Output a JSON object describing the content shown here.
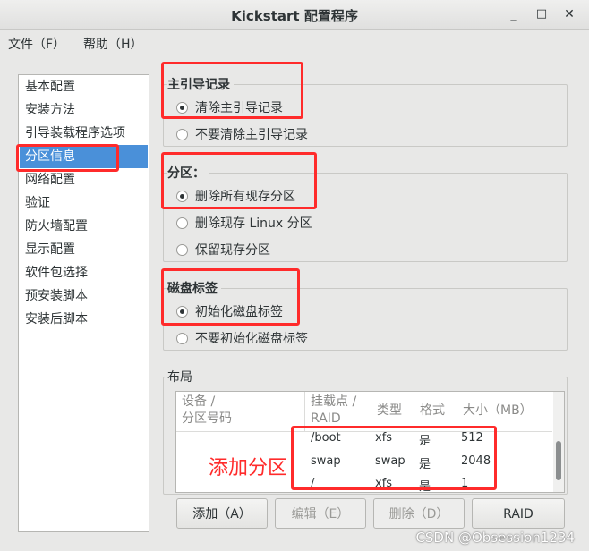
{
  "window": {
    "title": "Kickstart 配置程序",
    "minimize": "_",
    "maximize": "□",
    "close": "✕"
  },
  "menu": {
    "file": "文件（F）",
    "help": "帮助（H）"
  },
  "sidebar": {
    "items": [
      "基本配置",
      "安装方法",
      "引导装载程序选项",
      "分区信息",
      "网络配置",
      "验证",
      "防火墙配置",
      "显示配置",
      "软件包选择",
      "预安装脚本",
      "安装后脚本"
    ],
    "selected": "分区信息"
  },
  "mbr": {
    "label": "主引导记录",
    "opt1": "清除主引导记录",
    "opt2": "不要清除主引导记录",
    "selected": "清除主引导记录"
  },
  "partition": {
    "label": "分区：",
    "opt1": "删除所有现存分区",
    "opt2": "删除现存  Linux 分区",
    "opt3": "保留现存分区",
    "selected": "删除所有现存分区"
  },
  "disklabel": {
    "label": "磁盘标签",
    "opt1": "初始化磁盘标签",
    "opt2": "不要初始化磁盘标签",
    "selected": "初始化磁盘标签"
  },
  "layout": {
    "label": "布局",
    "headers": {
      "device": "设备 /\n分区号码",
      "mount": "挂载点 /\nRAID",
      "type": "类型",
      "format": "格式",
      "size": "大小（MB）"
    },
    "rows": [
      {
        "mount": "/boot",
        "type": "xfs",
        "format": "是",
        "size": "512"
      },
      {
        "mount": "swap",
        "type": "swap",
        "format": "是",
        "size": "2048"
      },
      {
        "mount": "/",
        "type": "xfs",
        "format": "是",
        "size": "1"
      }
    ]
  },
  "buttons": {
    "add": "添加（A）",
    "edit": "编辑（E）",
    "delete": "删除（D）",
    "raid": "RAID"
  },
  "annotation": "添加分区",
  "watermark": "CSDN @Obsession1234",
  "colors": {
    "accent": "#4a90d9",
    "highlight": "#ff2b2b"
  }
}
